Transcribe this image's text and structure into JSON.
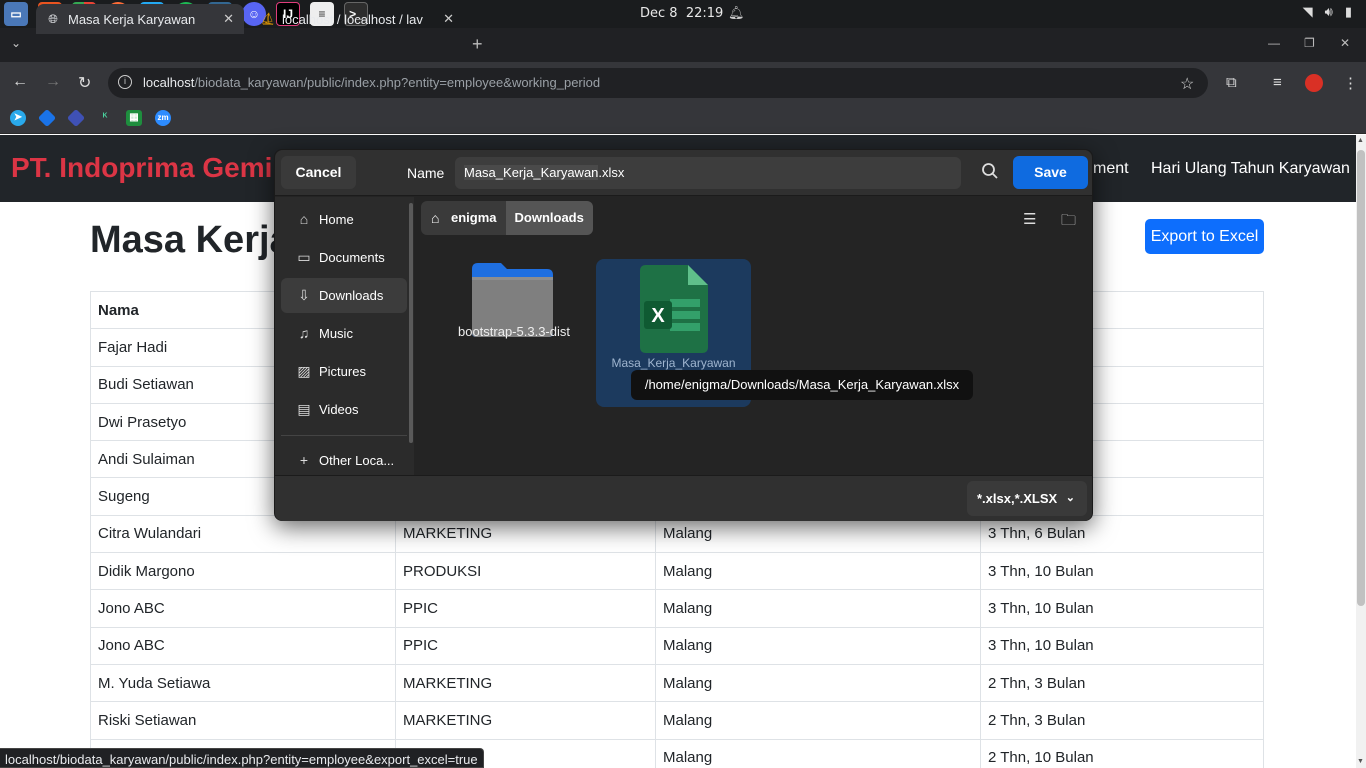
{
  "os_bar": {
    "date": "Dec 8",
    "time": "22:19",
    "apps": [
      "files-icon",
      "app-store-icon",
      "chrome-icon",
      "postman-icon",
      "vscode-icon",
      "spotify-icon",
      "postgres-icon",
      "discord-icon",
      "intellij-icon",
      "text-editor-icon",
      "terminal-icon"
    ],
    "colors": {
      "bar_bg": "#1a1c1e"
    }
  },
  "browser": {
    "tabs": [
      {
        "label": "Masa Kerja Karyawan",
        "icon": "globe-icon",
        "active": true
      },
      {
        "label": "localhost / localhost / lav",
        "icon": "phpmyadmin-icon",
        "active": false
      }
    ],
    "url_host": "localhost",
    "url_path": "/biodata_karyawan/public/index.php?entity=employee&working_period",
    "bookmarks": [
      "telegram-icon",
      "bookmark-blue-icon",
      "bookmark-blue2-icon",
      "vk-icon",
      "sheets-icon",
      "zoom-icon"
    ],
    "status_url": "localhost/biodata_karyawan/public/index.php?entity=employee&export_excel=true"
  },
  "page": {
    "brand": "PT. Indoprima Gemil",
    "nav_links": [
      "ment",
      "Hari Ulang Tahun Karyawan"
    ],
    "title": "Masa Kerja",
    "export_button": "Export to Excel",
    "table_header": {
      "nama": "Nama"
    },
    "rows": [
      {
        "nama": "Fajar Hadi",
        "dept": "",
        "lokasi": "",
        "masa": ""
      },
      {
        "nama": "Budi Setiawan",
        "dept": "",
        "lokasi": "",
        "masa": ""
      },
      {
        "nama": "Dwi Prasetyo",
        "dept": "",
        "lokasi": "",
        "masa": ""
      },
      {
        "nama": "Andi Sulaiman",
        "dept": "",
        "lokasi": "",
        "masa": ""
      },
      {
        "nama": "Sugeng",
        "dept": "",
        "lokasi": "",
        "masa": ""
      },
      {
        "nama": "Citra Wulandari",
        "dept": "MARKETING",
        "lokasi": "Malang",
        "masa": "3 Thn, 6 Bulan"
      },
      {
        "nama": "Didik Margono",
        "dept": "PRODUKSI",
        "lokasi": "Malang",
        "masa": "3 Thn, 10 Bulan"
      },
      {
        "nama": "Jono ABC",
        "dept": "PPIC",
        "lokasi": "Malang",
        "masa": "3 Thn, 10 Bulan"
      },
      {
        "nama": "Jono ABC",
        "dept": "PPIC",
        "lokasi": "Malang",
        "masa": "3 Thn, 10 Bulan"
      },
      {
        "nama": "M. Yuda Setiawa",
        "dept": "MARKETING",
        "lokasi": "Malang",
        "masa": "2 Thn, 3 Bulan"
      },
      {
        "nama": "Riski Setiawan",
        "dept": "MARKETING",
        "lokasi": "Malang",
        "masa": "2 Thn, 3 Bulan"
      },
      {
        "nama": "",
        "dept": "",
        "lokasi": "Malang",
        "masa": "2 Thn, 10 Bulan"
      }
    ],
    "colors": {
      "brand": "#dc3545",
      "navbar_bg": "#212529",
      "primary": "#0d6efd"
    }
  },
  "dialog": {
    "cancel": "Cancel",
    "name_label": "Name",
    "filename_stem": "Masa_Kerja_Karyawan",
    "filename_ext": ".xlsx",
    "save": "Save",
    "places": [
      {
        "label": "Home",
        "icon": "home-icon"
      },
      {
        "label": "Documents",
        "icon": "document-icon"
      },
      {
        "label": "Downloads",
        "icon": "download-icon",
        "active": true
      },
      {
        "label": "Music",
        "icon": "music-icon"
      },
      {
        "label": "Pictures",
        "icon": "picture-icon"
      },
      {
        "label": "Videos",
        "icon": "video-icon"
      },
      {
        "label": "Other Loca...",
        "icon": "plus-icon"
      }
    ],
    "breadcrumb": [
      "enigma",
      "Downloads"
    ],
    "files": [
      {
        "label": "bootstrap-5.3.3-dist",
        "type": "folder"
      },
      {
        "label": "Masa_Kerja_Karyawan .xlsx",
        "type": "excel"
      }
    ],
    "tooltip": "/home/enigma/Downloads/Masa_Kerja_Karyawan.xlsx",
    "filter": "*.xlsx,*.XLSX",
    "colors": {
      "save": "#0f6be0",
      "selection": "#1c3a5e",
      "excel": "#1e7145"
    }
  }
}
